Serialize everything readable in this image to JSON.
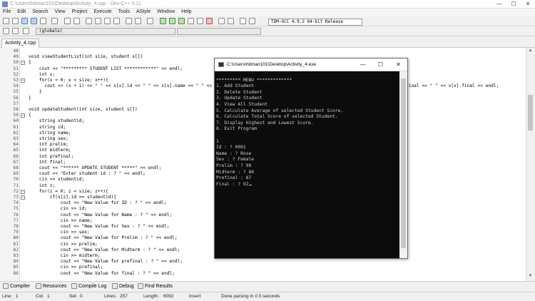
{
  "window": {
    "title": "C:\\Users\\hitman101\\Desktop\\Activity_4.cpp - Dev-C++ 5.11",
    "controls": {
      "minimize": "—",
      "maximize": "☐",
      "close": "✕"
    }
  },
  "menu": [
    "File",
    "Edit",
    "Search",
    "View",
    "Project",
    "Execute",
    "Tools",
    "AStyle",
    "Window",
    "Help"
  ],
  "toolbar": {
    "compiler": "TDM-GCC 4.9.2 64-bit Release",
    "scope": "(globals)"
  },
  "tabs": [
    {
      "label": "Activity_4.cpp"
    }
  ],
  "editor": {
    "lines": [
      {
        "n": "48",
        "fold": "",
        "code": ""
      },
      {
        "n": "49",
        "fold": "",
        "code": "void viewStudentList(int size, student s[])"
      },
      {
        "n": "50",
        "fold": "−",
        "code": "{"
      },
      {
        "n": "51",
        "fold": "",
        "code": "    cout << \"********* STUDENT LIST ************\" << endl;"
      },
      {
        "n": "52",
        "fold": "",
        "code": "    int x;"
      },
      {
        "n": "53",
        "fold": "−",
        "code": "    for(x = 0; x < size; x++){"
      },
      {
        "n": "54",
        "fold": "",
        "code": "      cout << (x + 1) << \" \" << s[x].id << \" \" << s[x].name << \" \" << s[x].sex << \" \" << s[x].prelim << \" \" << s[x].midterm << \" \" << s[x].prefinal << \" \" << s[x].final << endl;"
      },
      {
        "n": "55",
        "fold": "",
        "code": "    }"
      },
      {
        "n": "56",
        "fold": "",
        "code": "}"
      },
      {
        "n": "57",
        "fold": "",
        "code": ""
      },
      {
        "n": "58",
        "fold": "",
        "code": "void updateStudent(int size, student s[])"
      },
      {
        "n": "59",
        "fold": "−",
        "code": "{"
      },
      {
        "n": "60",
        "fold": "",
        "code": "    string studentid;"
      },
      {
        "n": "61",
        "fold": "",
        "code": "    string id;"
      },
      {
        "n": "62",
        "fold": "",
        "code": "    string name;"
      },
      {
        "n": "63",
        "fold": "",
        "code": "    string sex;"
      },
      {
        "n": "64",
        "fold": "",
        "code": "    int prelim;"
      },
      {
        "n": "65",
        "fold": "",
        "code": "    int midterm;"
      },
      {
        "n": "66",
        "fold": "",
        "code": "    int prefinal;"
      },
      {
        "n": "67",
        "fold": "",
        "code": "    int final;"
      },
      {
        "n": "68",
        "fold": "",
        "code": "    cout << \"****** UPDATE STUDENT *****\" << endl;"
      },
      {
        "n": "69",
        "fold": "",
        "code": "    cout << \"Enter student id : ? \" << endl;"
      },
      {
        "n": "70",
        "fold": "",
        "code": "    cin >> studentid;"
      },
      {
        "n": "71",
        "fold": "",
        "code": "    int z;"
      },
      {
        "n": "72",
        "fold": "−",
        "code": "    for(z = 0; z < size; z++){"
      },
      {
        "n": "73",
        "fold": "−",
        "code": "        if(s[z].id == studentid){"
      },
      {
        "n": "74",
        "fold": "",
        "code": "            cout << \"New Value for ID : ? \" << endl;"
      },
      {
        "n": "75",
        "fold": "",
        "code": "            cin >> id;"
      },
      {
        "n": "76",
        "fold": "",
        "code": "            cout << \"New Value for Name : ? \" << endl;"
      },
      {
        "n": "77",
        "fold": "",
        "code": "            cin >> name;"
      },
      {
        "n": "78",
        "fold": "",
        "code": "            cout << \"New Value for Sex : ? \" << endl;"
      },
      {
        "n": "79",
        "fold": "",
        "code": "            cin >> sex;"
      },
      {
        "n": "80",
        "fold": "",
        "code": "            cout << \"New Value for Prelim : ? \" << endl;"
      },
      {
        "n": "81",
        "fold": "",
        "code": "            cin >> prelim;"
      },
      {
        "n": "82",
        "fold": "",
        "code": "            cout << \"New Value for Midterm : ? \" << endl;"
      },
      {
        "n": "83",
        "fold": "",
        "code": "            cin >> midterm;"
      },
      {
        "n": "84",
        "fold": "",
        "code": "            cout << \"New Value for prefinal : ? \" << endl;"
      },
      {
        "n": "85",
        "fold": "",
        "code": "            cin >> prefinal;"
      },
      {
        "n": "86",
        "fold": "",
        "code": "            cout << \"New Value for final : ? \" << endl;"
      }
    ]
  },
  "console": {
    "title": "C:\\Users\\hitman101\\Desktop\\Activity_4.exe",
    "controls": {
      "minimize": "—",
      "maximize": "☐",
      "close": "✕"
    },
    "lines": [
      "",
      "********* MENU *************",
      "1. Add Student",
      "2. Delete Student",
      "3. Update Student",
      "4. View All Student",
      "5. Calculate Average of selected Student Score.",
      "6. Calculate Total Score of selected Student.",
      "7. Display Highest and Lowest Score.",
      "8. Exit Program",
      "",
      "1",
      "Id : ? 0001",
      "Name : ? Rose",
      "Sex : ? Female",
      "Prelim : ? 90",
      "Midterm : ? 88",
      "Prefinal : 87",
      "Final : ? 92"
    ]
  },
  "bottom_tabs": [
    "Compiler",
    "Resources",
    "Compile Log",
    "Debug",
    "Find Results"
  ],
  "status": {
    "line_label": "Line:",
    "line": "1",
    "col_label": "Col:",
    "col": "1",
    "sel_label": "Sel:",
    "sel": "0",
    "lines_label": "Lines:",
    "lines": "257",
    "length_label": "Length:",
    "length": "6092",
    "mode": "Insert",
    "message": "Done parsing in 0.5 seconds"
  }
}
